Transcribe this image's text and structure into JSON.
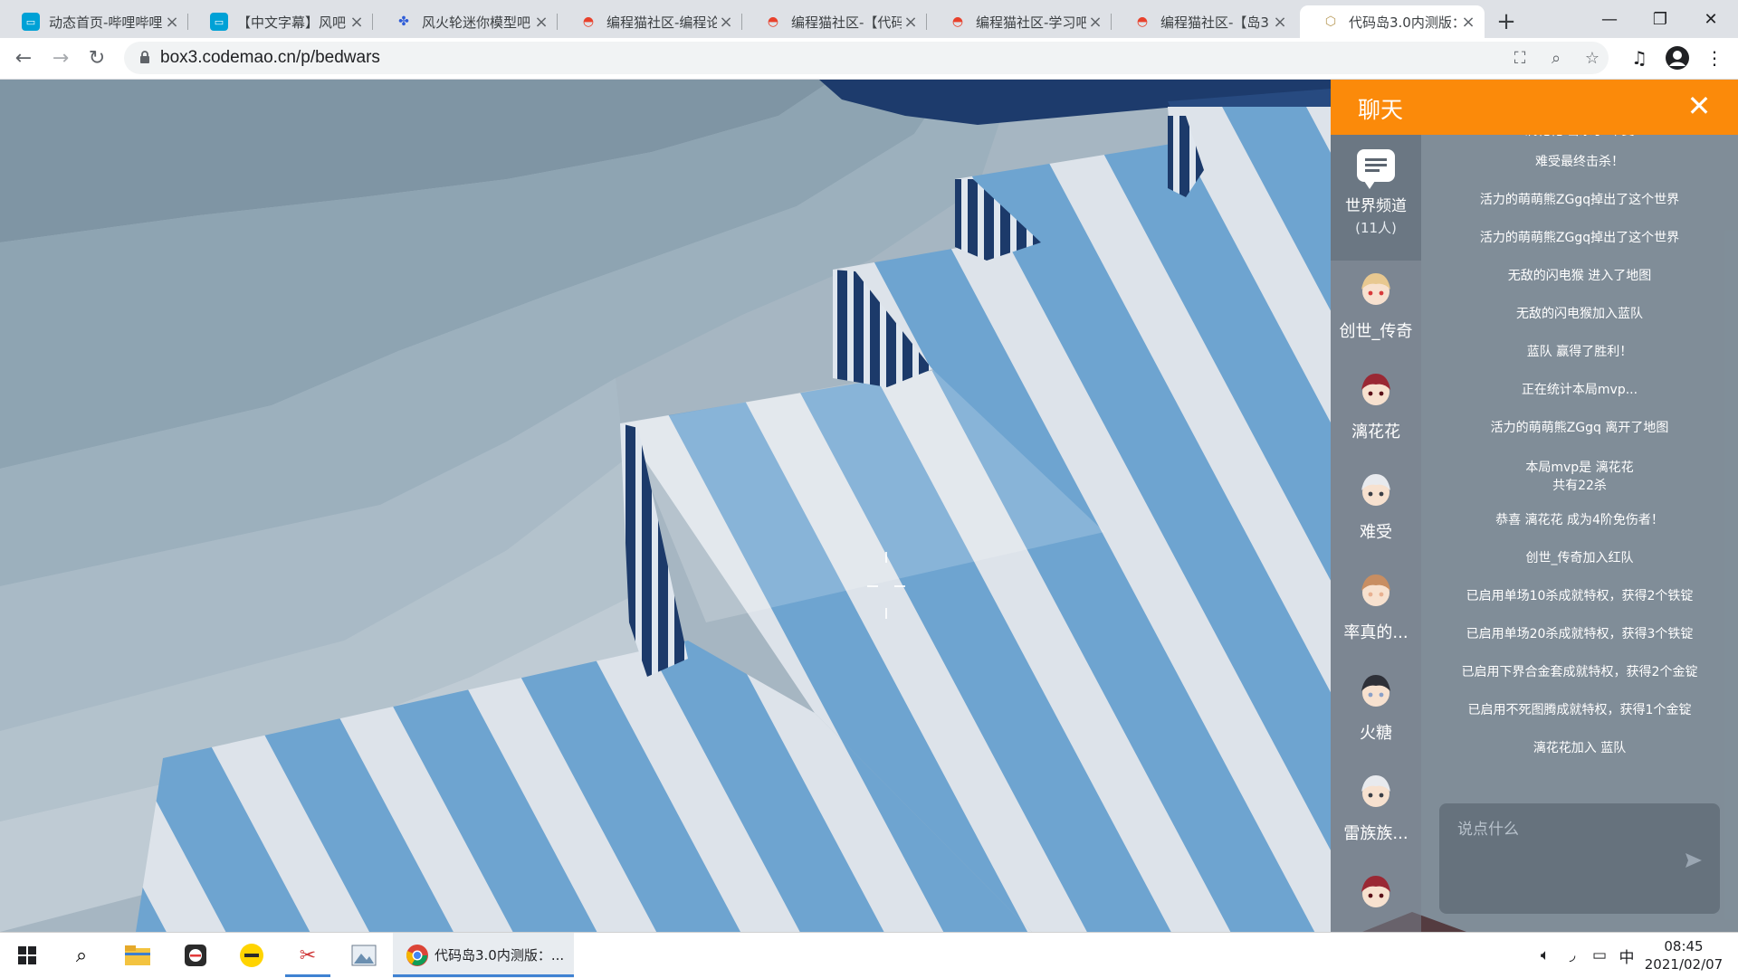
{
  "browser": {
    "tabs": [
      {
        "title": "动态首页-哔哩哔哩",
        "icon": "bilibili-icon"
      },
      {
        "title": "【中文字幕】风吧",
        "icon": "bilibili-icon"
      },
      {
        "title": "风火轮迷你模型吧",
        "icon": "baidu-paw-icon"
      },
      {
        "title": "编程猫社区-编程论",
        "icon": "codemao-icon"
      },
      {
        "title": "编程猫社区-【代码",
        "icon": "codemao-icon"
      },
      {
        "title": "编程猫社区-学习吧",
        "icon": "codemao-icon"
      },
      {
        "title": "编程猫社区-【岛3",
        "icon": "codemao-icon"
      },
      {
        "title": "代码岛3.0内测版：",
        "icon": "box3-cube-icon"
      }
    ],
    "url": "box3.codemao.cn/p/bedwars"
  },
  "chat": {
    "title": "聊天",
    "world_channel": {
      "name": "世界频道",
      "count": "(11人)"
    },
    "players": [
      {
        "name": "创世_传奇",
        "hair": "#e8c890",
        "accent": "#d83a3a"
      },
      {
        "name": "漓花花",
        "hair": "#9a2834",
        "accent": "#5a1018"
      },
      {
        "name": "难受",
        "hair": "#e8eaee",
        "accent": "#3a3e46"
      },
      {
        "name": "率真的...",
        "hair": "#c88e62",
        "accent": "#e8b090"
      },
      {
        "name": "火糖",
        "hair": "#2e3038",
        "accent": "#8aa0c8"
      },
      {
        "name": "雷族族...",
        "hair": "#e8eaee",
        "accent": "#3a3e46"
      },
      {
        "name": "",
        "hair": "#9a2834",
        "accent": "#5a1018"
      }
    ],
    "messages": [
      "漓花花 击杀了 难受",
      "难受最终击杀！",
      "活力的萌萌熊ZGgq掉出了这个世界",
      "活力的萌萌熊ZGgq掉出了这个世界",
      "无敌的闪电猴 进入了地图",
      "无敌的闪电猴加入蓝队",
      "蓝队 赢得了胜利！",
      "正在统计本局mvp...",
      "活力的萌萌熊ZGgq 离开了地图",
      "本局mvp是 漓花花\n共有22杀",
      "恭喜 漓花花 成为4阶免伤者！",
      "创世_传奇加入红队",
      "已启用单场10杀成就特权，获得2个铁锭",
      "已启用单场20杀成就特权，获得3个铁锭",
      "已启用下界合金套成就特权，获得2个金锭",
      "已启用不死图腾成就特权，获得1个金锭",
      "漓花花加入 蓝队"
    ],
    "input_placeholder": "说点什么"
  },
  "taskbar": {
    "active_app_label": "代码岛3.0内测版：...",
    "time": "08:45",
    "date": "2021/02/07",
    "ime": "中"
  },
  "colors": {
    "chat_header": "#fb8a0a",
    "stripe_blue": "#6ea4d0",
    "stripe_white": "#dde3ea",
    "wall_dark": "#1c3a6a",
    "taskbar_accent": "#3f82d2"
  }
}
